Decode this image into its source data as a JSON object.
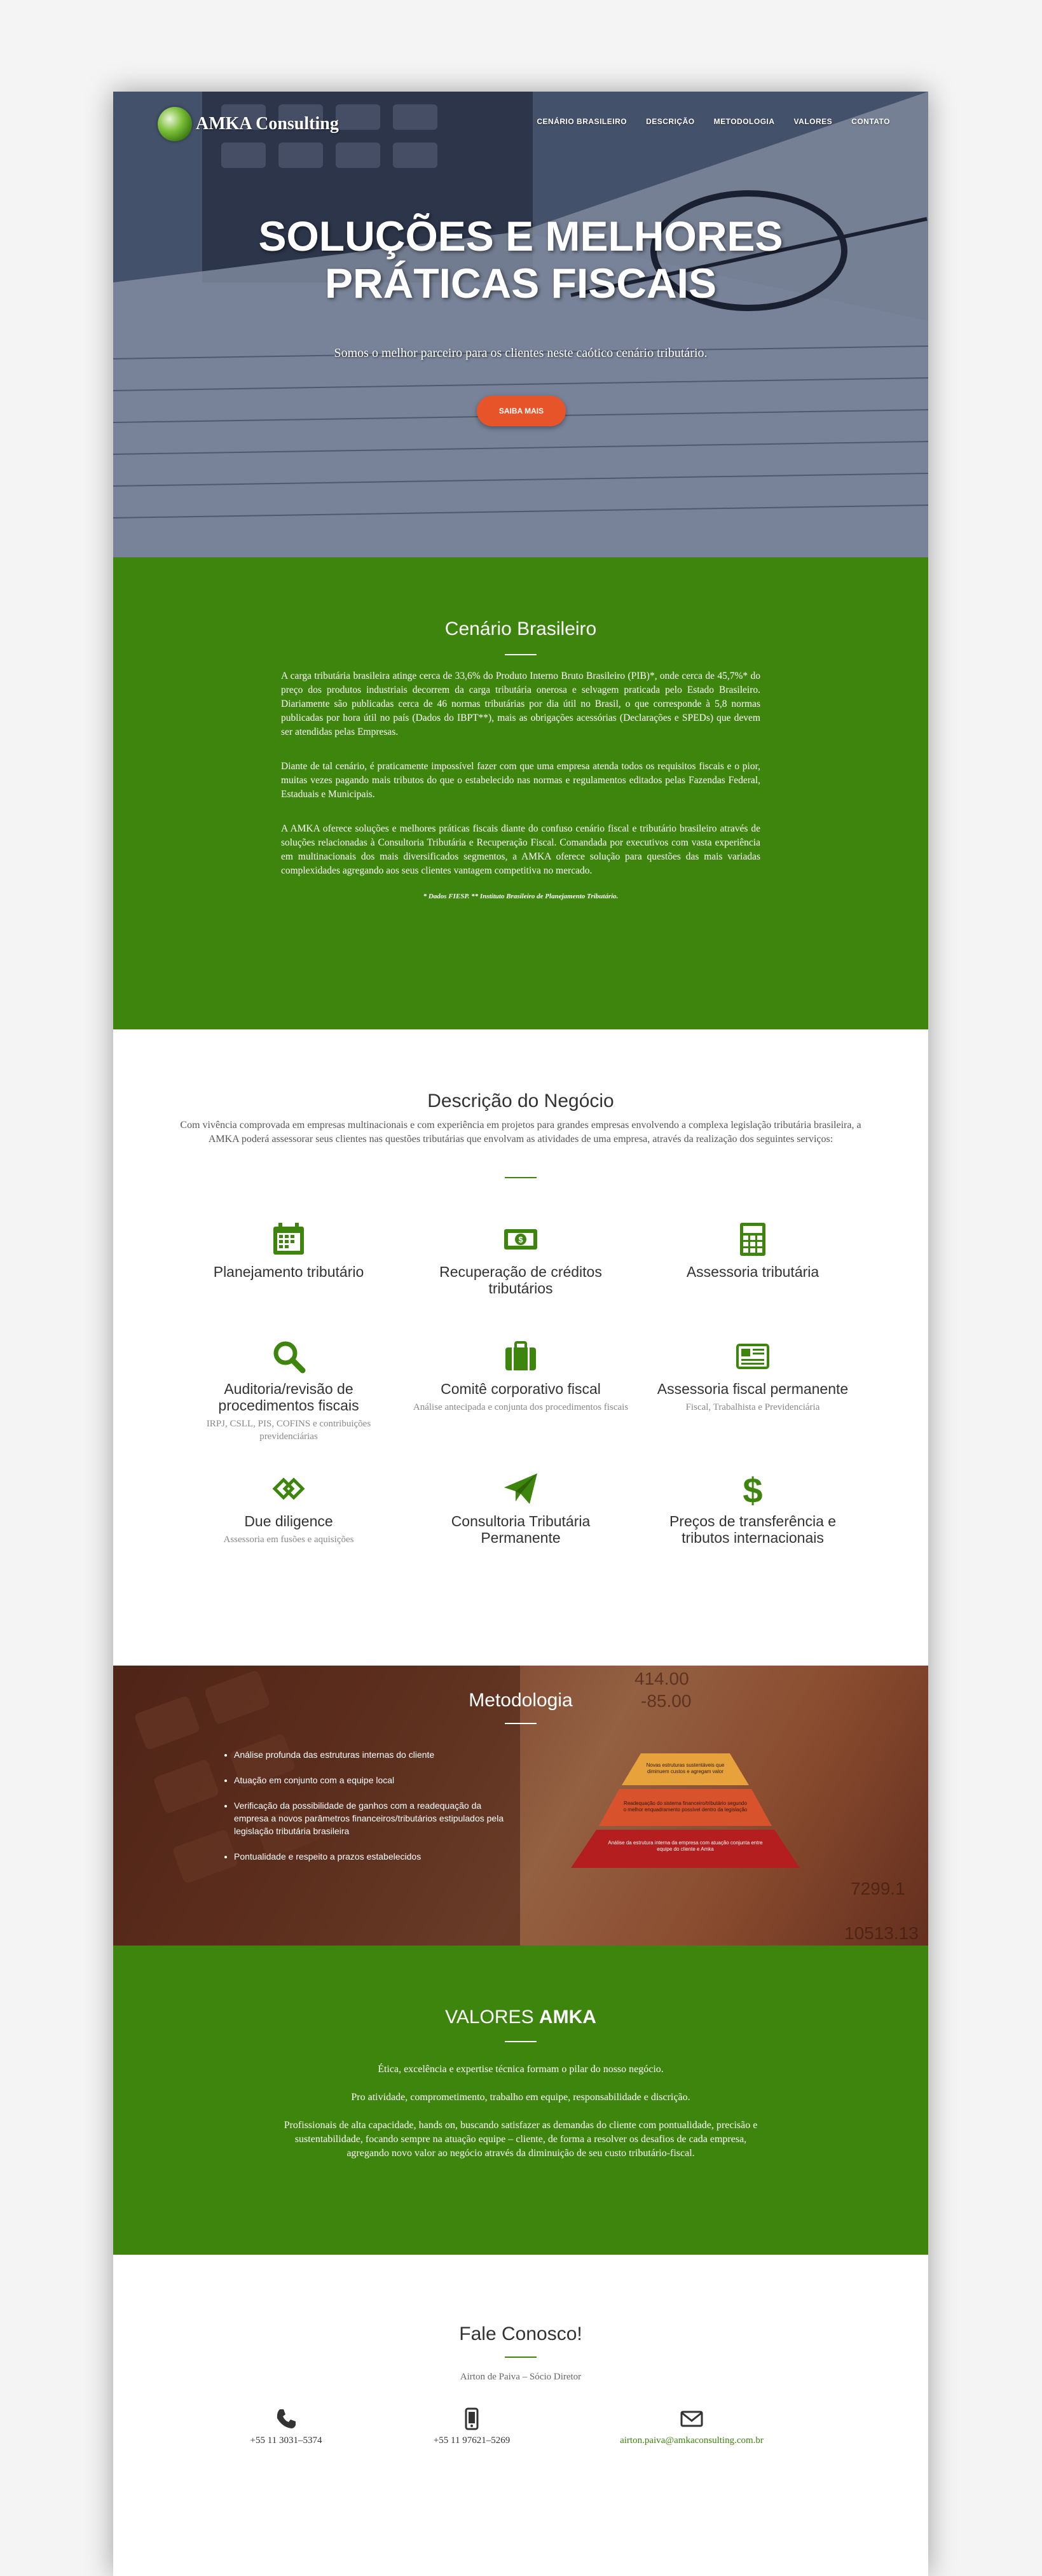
{
  "header": {
    "logo_text": "AMKA Consulting",
    "nav": [
      "CENÁRIO BRASILEIRO",
      "DESCRIÇÃO",
      "METODOLOGIA",
      "VALORES",
      "CONTATO"
    ]
  },
  "hero": {
    "title_line1": "SOLUÇÕES E MELHORES",
    "title_line2": "PRÁTICAS FISCAIS",
    "subtitle": "Somos o melhor parceiro para os clientes neste caótico cenário tributário.",
    "button": "SAIBA MAIS"
  },
  "cenario": {
    "title": "Cenário Brasileiro",
    "p1": "A carga tributária brasileira atinge cerca de 33,6% do Produto Interno Bruto Brasileiro (PIB)*, onde cerca de 45,7%* do preço dos produtos industriais decorrem da carga tributária onerosa e selvagem praticada pelo Estado Brasileiro. Diariamente são publicadas cerca de 46 normas tributárias por dia útil no Brasil, o que corresponde à 5,8 normas publicadas por hora útil no país (Dados do IBPT**), mais as obrigações acessórias (Declarações e SPEDs) que devem ser atendidas pelas Empresas.",
    "p2": "Diante de tal cenário, é praticamente impossível fazer com que uma empresa atenda todos os requisitos fiscais e o pior, muitas vezes pagando mais tributos do que o estabelecido nas normas e regulamentos editados pelas Fazendas Federal, Estaduais e Municipais.",
    "p3": "A AMKA oferece soluções e melhores práticas fiscais diante do confuso cenário fiscal e tributário brasileiro através de soluções relacionadas à Consultoria Tributária e Recuperação Fiscal. Comandada por executivos com vasta experiência em multinacionais dos mais diversificados segmentos, a AMKA oferece solução para questões das mais variadas complexidades agregando aos seus clientes vantagem competitiva no mercado.",
    "footnote": "* Dados FIESP. ** Instituto Brasileiro de Planejamento Tributário."
  },
  "descricao": {
    "title": "Descrição do Negócio",
    "intro": "Com vivência comprovada em empresas multinacionais e com experiência em projetos para grandes empresas envolvendo a complexa legislação tributária brasileira, a AMKA poderá assessorar seus clientes nas questões tributárias que envolvam as atividades de uma empresa, através da realização dos seguintes serviços:",
    "services": [
      {
        "icon": "calendar-icon",
        "title": "Planejamento tributário",
        "desc": ""
      },
      {
        "icon": "money-icon",
        "title": "Recuperação de créditos tributários",
        "desc": ""
      },
      {
        "icon": "calculator-icon",
        "title": "Assessoria tributária",
        "desc": ""
      },
      {
        "icon": "search-icon",
        "title": "Auditoria/revisão de procedimentos fiscais",
        "desc": "IRPJ, CSLL, PIS, COFINS e contribuições previdenciárias"
      },
      {
        "icon": "briefcase-icon",
        "title": "Comitê corporativo fiscal",
        "desc": "Análise antecipada e conjunta dos procedimentos fiscais"
      },
      {
        "icon": "newspaper-icon",
        "title": "Assessoria fiscal permanente",
        "desc": "Fiscal, Trabalhista e Previdenciária"
      },
      {
        "icon": "handshake-icon",
        "title": "Due diligence",
        "desc": "Assessoria em fusões e aquisições"
      },
      {
        "icon": "paper-plane-icon",
        "title": "Consultoria Tributária Permanente",
        "desc": ""
      },
      {
        "icon": "dollar-icon",
        "title": "Preços de transferência e tributos internacionais",
        "desc": ""
      }
    ]
  },
  "metodologia": {
    "title": "Metodologia",
    "items": [
      "Análise profunda das estruturas internas do cliente",
      "Atuação em conjunto com a equipe local",
      "Verificação da possibilidade de ganhos com a readequação da empresa a novos parâmetros financeiros/tributários estipulados pela legislação tributária brasileira",
      "Pontualidade e respeito a prazos estabelecidos"
    ],
    "pyramid": [
      "Novas estruturas sustentáveis que diminuem custos e agregam valor",
      "Readequação do sistema financeiro/tributário segundo o melhor enquadramento possível dentro da legislação",
      "Análise da estrutura interna da empresa com atuação conjunta entre equipe do cliente e Amka"
    ]
  },
  "valores": {
    "title_prefix": "VALORES ",
    "title_bold": "AMKA",
    "p1": "Ética, excelência e expertise técnica formam o pilar do nosso negócio.",
    "p2": "Pro atividade, comprometimento, trabalho em equipe, responsabilidade e discrição.",
    "p3": "Profissionais de alta capacidade, hands on, buscando satisfazer as demandas do cliente com pontualidade, precisão e sustentabilidade, focando sempre na atuação equipe – cliente, de forma a resolver os desafios de cada empresa, agregando novo valor ao negócio através da diminuição de seu custo tributário-fiscal."
  },
  "contato": {
    "title": "Fale Conosco!",
    "person": "Airton de Paiva – Sócio Diretor",
    "phone": "+55 11 3031–5374",
    "mobile": "+55 11 97621–5269",
    "email": "airton.paiva@amkaconsulting.com.br"
  },
  "colors": {
    "accent_green": "#3e850e",
    "button_orange": "#e8542a"
  }
}
